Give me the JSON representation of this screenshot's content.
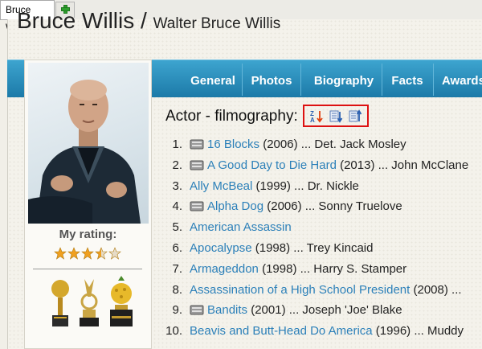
{
  "tabs": [
    {
      "label": "Bruce Willis",
      "active": true
    }
  ],
  "new_tab_icon": "plus-icon",
  "person": {
    "name": "Bruce Willis",
    "separator": "/",
    "full_name": "Walter Bruce Willis"
  },
  "nav": [
    {
      "label": "General"
    },
    {
      "label": "Photos"
    },
    {
      "label": "Biography"
    },
    {
      "label": "Facts"
    },
    {
      "label": "Awards"
    }
  ],
  "rating": {
    "label": "My rating:",
    "value": 3.5,
    "max": 5
  },
  "filmography": {
    "heading": "Actor - filmography:",
    "sort_icons": [
      "sort-alpha-icon",
      "sort-descending-icon",
      "sort-ascending-icon"
    ],
    "films": [
      {
        "num": "1.",
        "has_icon": true,
        "title": "16 Blocks",
        "year": "(2006)",
        "role": "... Det. Jack Mosley"
      },
      {
        "num": "2.",
        "has_icon": true,
        "title": "A Good Day to Die Hard",
        "year": "(2013)",
        "role": "... John McClane"
      },
      {
        "num": "3.",
        "has_icon": false,
        "title": "Ally McBeal",
        "year": "(1999)",
        "role": "... Dr. Nickle"
      },
      {
        "num": "4.",
        "has_icon": true,
        "title": "Alpha Dog",
        "year": "(2006)",
        "role": "... Sonny Truelove"
      },
      {
        "num": "5.",
        "has_icon": false,
        "title": "American Assassin",
        "year": "",
        "role": ""
      },
      {
        "num": "6.",
        "has_icon": false,
        "title": "Apocalypse",
        "year": "(1998)",
        "role": "... Trey Kincaid"
      },
      {
        "num": "7.",
        "has_icon": false,
        "title": "Armageddon",
        "year": "(1998)",
        "role": "... Harry S. Stamper"
      },
      {
        "num": "8.",
        "has_icon": false,
        "title": "Assassination of a High School President",
        "year": "(2008)",
        "role": "..."
      },
      {
        "num": "9.",
        "has_icon": true,
        "title": "Bandits",
        "year": "(2001)",
        "role": "... Joseph 'Joe' Blake"
      },
      {
        "num": "10.",
        "has_icon": false,
        "title": "Beavis and Butt-Head Do America",
        "year": "(1996)",
        "role": "... Muddy"
      }
    ]
  },
  "colors": {
    "accent_nav": "#1c7aa8",
    "link": "#2c80b9",
    "highlight_border": "#dd1111",
    "star": "#f0a020"
  }
}
